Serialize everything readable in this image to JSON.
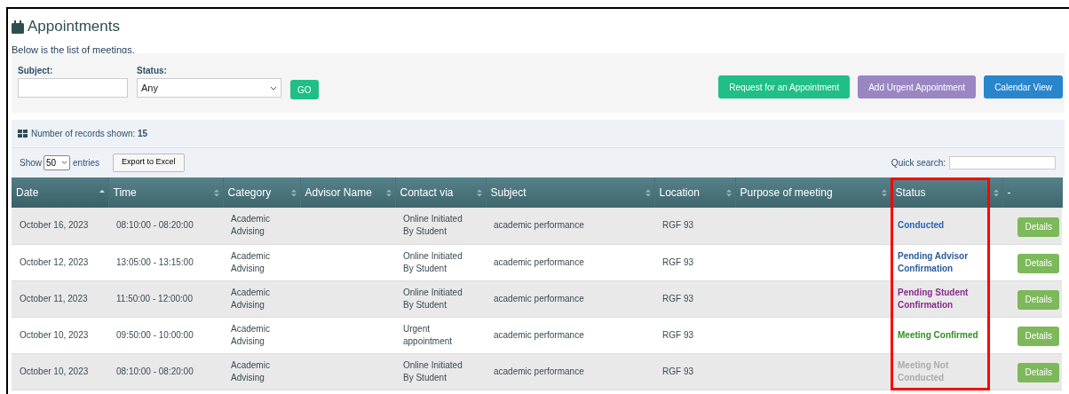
{
  "title": "Appointments",
  "intro": "Below is the list of meetings.",
  "filters": {
    "subject_label": "Subject:",
    "status_label": "Status:",
    "status_value": "Any",
    "go": "GO"
  },
  "actions": [
    {
      "label": "Request for an Appointment",
      "kind": "request"
    },
    {
      "label": "Add Urgent Appointment",
      "kind": "urgent"
    },
    {
      "label": "Calendar View",
      "kind": "calendar"
    }
  ],
  "records": {
    "label": "Number of records shown: ",
    "count": "15"
  },
  "show": {
    "before": "Show",
    "value": "50",
    "after": "entries"
  },
  "export": "Export to Excel",
  "quick_search_label": "Quick search:",
  "table": {
    "columns": [
      {
        "label": "Date",
        "sortable": true,
        "sorted_ascending": true
      },
      {
        "label": "Time",
        "sortable": true,
        "sorted_ascending": false
      },
      {
        "label": "Category",
        "sortable": true,
        "sorted_ascending": false
      },
      {
        "label": "Advisor Name",
        "sortable": true,
        "sorted_ascending": false
      },
      {
        "label": "Contact via",
        "sortable": true,
        "sorted_ascending": false
      },
      {
        "label": "Subject",
        "sortable": true,
        "sorted_ascending": false
      },
      {
        "label": "Location",
        "sortable": true,
        "sorted_ascending": false
      },
      {
        "label": "Purpose of meeting",
        "sortable": true,
        "sorted_ascending": false
      },
      {
        "label": "Status",
        "sortable": true,
        "sorted_ascending": false,
        "highlighted": true
      },
      {
        "label": "-",
        "sortable": false
      }
    ],
    "rows": [
      {
        "date": "October 16, 2023",
        "time": "08:10:00 - 08:20:00",
        "category": "Academic Advising",
        "contact": "Online Initiated By Student",
        "subject": "academic performance",
        "location": "RGF 93",
        "status": "Conducted",
        "color": "#2a62b8",
        "action": "Details"
      },
      {
        "date": "October 12, 2023",
        "time": "13:05:00 - 13:15:00",
        "category": "Academic Advising",
        "contact": "Online Initiated By Student",
        "subject": "academic performance",
        "location": "RGF 93",
        "status": "Pending Advisor Confirmation",
        "color": "#2a5b9a",
        "action": "Details"
      },
      {
        "date": "October 11, 2023",
        "time": "11:50:00 - 12:00:00",
        "category": "Academic Advising",
        "contact": "Online Initiated By Student",
        "subject": "academic performance",
        "location": "RGF 93",
        "status": "Pending Student Confirmation",
        "color": "#8a2a8c",
        "action": "Details"
      },
      {
        "date": "October 10, 2023",
        "time": "09:50:00 - 10:00:00",
        "category": "Academic Advising",
        "contact": "Urgent appointment",
        "subject": "academic performance",
        "location": "RGF 93",
        "status": "Meeting Confirmed",
        "color": "#2f8f1f",
        "action": "Details"
      },
      {
        "date": "October 10, 2023",
        "time": "08:10:00 - 08:20:00",
        "category": "Academic Advising",
        "contact": "Online Initiated By Student",
        "subject": "academic performance",
        "location": "RGF 93",
        "status": "Meeting Not Conducted",
        "color": "#aaaaaa",
        "action": "Details"
      }
    ]
  }
}
